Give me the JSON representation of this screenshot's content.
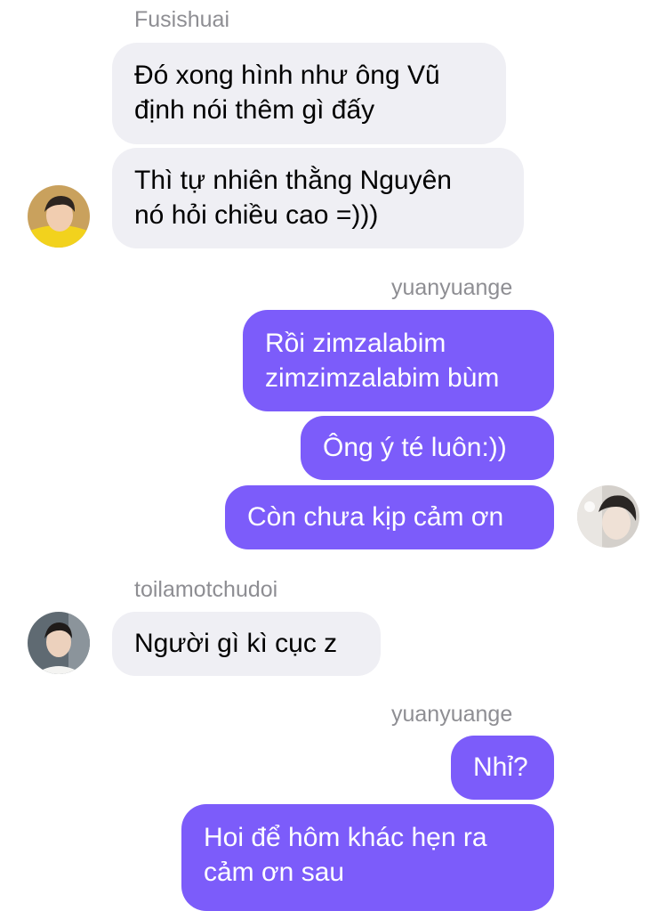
{
  "thread": {
    "groups": [
      {
        "sender": "Fusishuai",
        "direction": "incoming",
        "messages": [
          {
            "lines": [
              "Đó xong hình như ông Vũ",
              "định nói thêm gì đấy"
            ]
          },
          {
            "lines": [
              "Thì tự nhiên thằng Nguyên",
              "nó hỏi chiều cao =)))"
            ]
          }
        ]
      },
      {
        "sender": "yuanyuange",
        "direction": "outgoing",
        "messages": [
          {
            "lines": [
              "Rồi zimzalabim",
              "zimzimzalabim bùm"
            ]
          },
          {
            "lines": [
              "Ông ý té luôn:))"
            ]
          },
          {
            "lines": [
              "Còn chưa kịp cảm ơn"
            ]
          }
        ]
      },
      {
        "sender": "toilamotchudoi",
        "direction": "incoming",
        "messages": [
          {
            "lines": [
              "Người gì kì cục z"
            ]
          }
        ]
      },
      {
        "sender": "yuanyuange",
        "direction": "outgoing",
        "messages": [
          {
            "lines": [
              "Nhỉ?"
            ]
          },
          {
            "lines": [
              "Hoi để hôm khác hẹn ra",
              "cảm ơn sau"
            ]
          }
        ]
      }
    ]
  },
  "colors": {
    "incoming_bubble": "#efeff4",
    "outgoing_bubble": "#7c5cfa",
    "sender_name": "#8e8e93"
  }
}
